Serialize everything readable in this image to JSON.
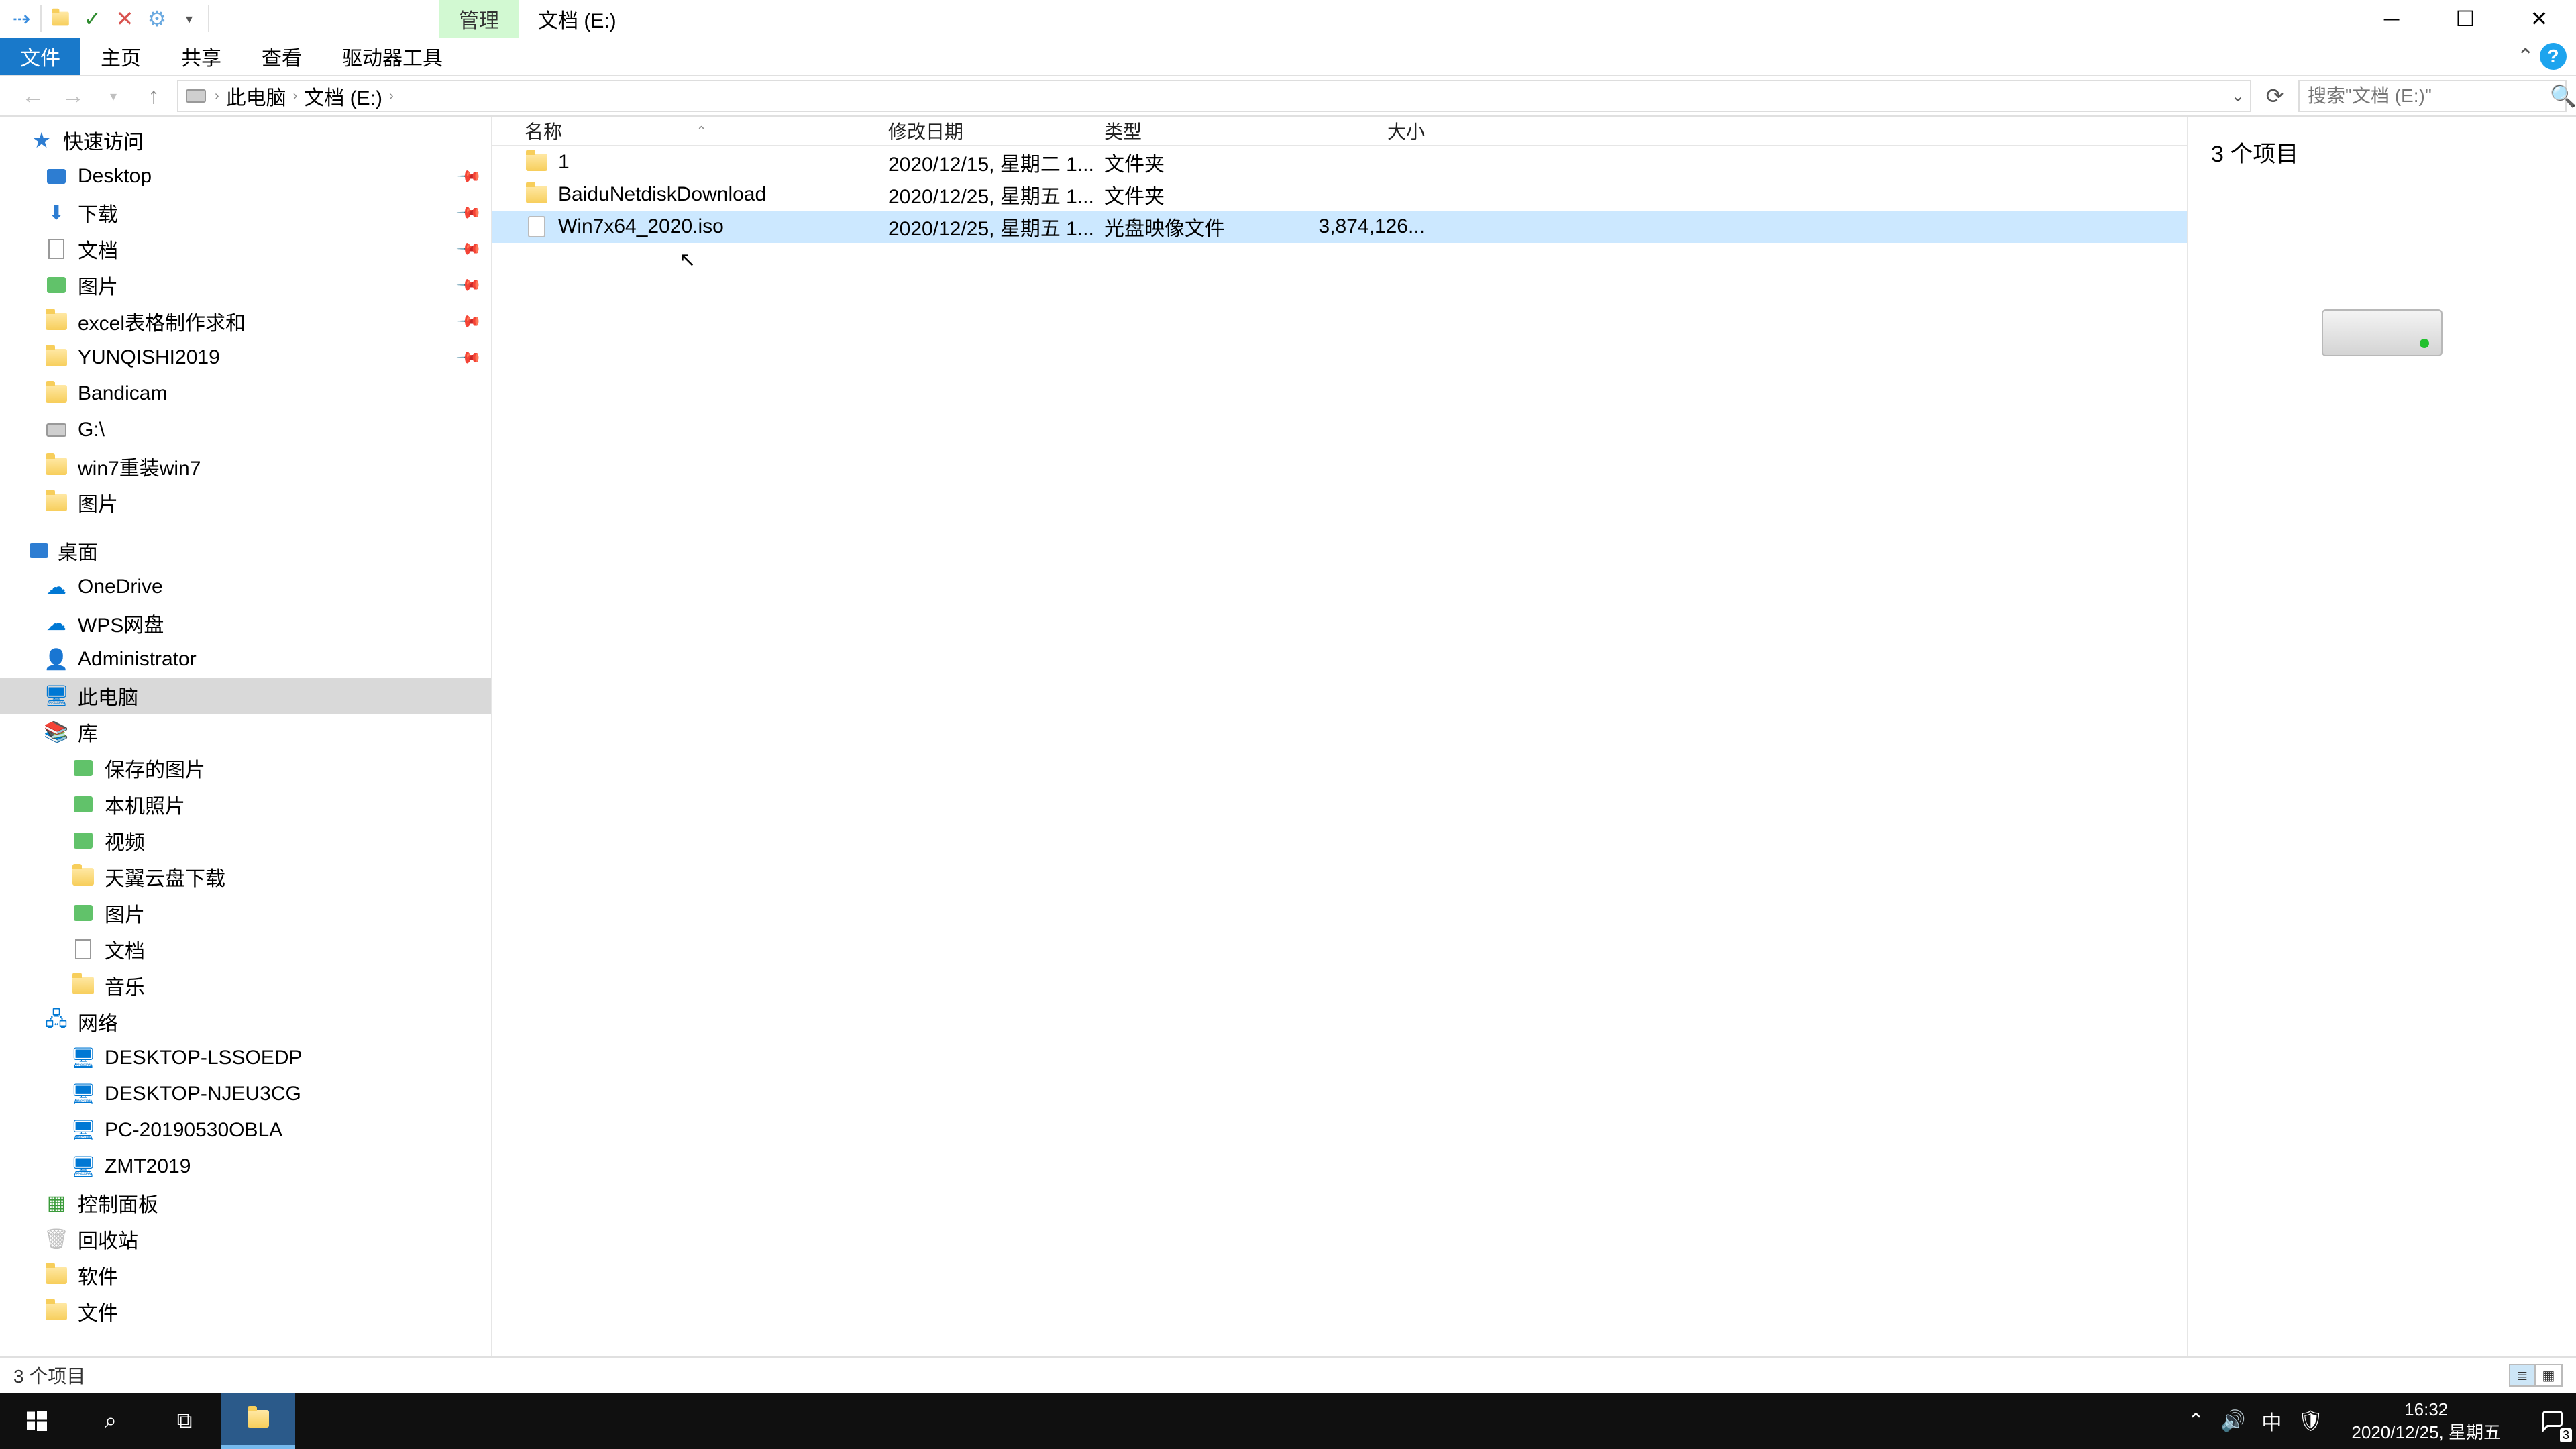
{
  "title_bar": {
    "contextual_tab": "管理",
    "window_title": "文档 (E:)"
  },
  "ribbon": {
    "file": "文件",
    "home": "主页",
    "share": "共享",
    "view": "查看",
    "drive_tools": "驱动器工具"
  },
  "address": {
    "crumbs": [
      "此电脑",
      "文档 (E:)"
    ],
    "refresh_tooltip": "刷新"
  },
  "search": {
    "placeholder": "搜索\"文档 (E:)\""
  },
  "columns": {
    "name": "名称",
    "date": "修改日期",
    "type": "类型",
    "size": "大小"
  },
  "rows": [
    {
      "icon": "folder",
      "name": "1",
      "date": "2020/12/15, 星期二 1...",
      "type": "文件夹",
      "size": "",
      "selected": false
    },
    {
      "icon": "folder",
      "name": "BaiduNetdiskDownload",
      "date": "2020/12/25, 星期五 1...",
      "type": "文件夹",
      "size": "",
      "selected": false
    },
    {
      "icon": "file",
      "name": "Win7x64_2020.iso",
      "date": "2020/12/25, 星期五 1...",
      "type": "光盘映像文件",
      "size": "3,874,126...",
      "selected": true
    }
  ],
  "preview": {
    "header": "3 个项目"
  },
  "nav": {
    "quick_access": "快速访问",
    "items_qa": [
      {
        "label": "Desktop",
        "icon": "desktop",
        "pinned": true
      },
      {
        "label": "下载",
        "icon": "dl",
        "pinned": true
      },
      {
        "label": "文档",
        "icon": "doc",
        "pinned": true
      },
      {
        "label": "图片",
        "icon": "pic",
        "pinned": true
      },
      {
        "label": "excel表格制作求和",
        "icon": "folder",
        "pinned": true
      },
      {
        "label": "YUNQISHI2019",
        "icon": "folder",
        "pinned": true
      },
      {
        "label": "Bandicam",
        "icon": "folder",
        "pinned": false
      },
      {
        "label": "G:\\",
        "icon": "drive",
        "pinned": false
      },
      {
        "label": "win7重装win7",
        "icon": "folder",
        "pinned": false
      },
      {
        "label": "图片",
        "icon": "folder",
        "pinned": false
      }
    ],
    "desktop_section": "桌面",
    "items_desktop": [
      {
        "label": "OneDrive",
        "icon": "onedrive"
      },
      {
        "label": "WPS网盘",
        "icon": "wps"
      },
      {
        "label": "Administrator",
        "icon": "user"
      },
      {
        "label": "此电脑",
        "icon": "pc",
        "selected": true
      },
      {
        "label": "库",
        "icon": "lib"
      },
      {
        "label": "保存的图片",
        "icon": "pic",
        "depth": 2
      },
      {
        "label": "本机照片",
        "icon": "pic",
        "depth": 2
      },
      {
        "label": "视频",
        "icon": "pic",
        "depth": 2
      },
      {
        "label": "天翼云盘下载",
        "icon": "folder",
        "depth": 2
      },
      {
        "label": "图片",
        "icon": "pic",
        "depth": 2
      },
      {
        "label": "文档",
        "icon": "doc",
        "depth": 2
      },
      {
        "label": "音乐",
        "icon": "folder",
        "depth": 2
      },
      {
        "label": "网络",
        "icon": "net"
      },
      {
        "label": "DESKTOP-LSSOEDP",
        "icon": "netpc",
        "depth": 2
      },
      {
        "label": "DESKTOP-NJEU3CG",
        "icon": "netpc",
        "depth": 2
      },
      {
        "label": "PC-20190530OBLA",
        "icon": "netpc",
        "depth": 2
      },
      {
        "label": "ZMT2019",
        "icon": "netpc",
        "depth": 2
      },
      {
        "label": "控制面板",
        "icon": "panel"
      },
      {
        "label": "回收站",
        "icon": "bin"
      },
      {
        "label": "软件",
        "icon": "folder"
      },
      {
        "label": "文件",
        "icon": "folder"
      }
    ]
  },
  "status": {
    "text": "3 个项目"
  },
  "taskbar": {
    "time": "16:32",
    "date": "2020/12/25, 星期五",
    "ime": "中"
  }
}
